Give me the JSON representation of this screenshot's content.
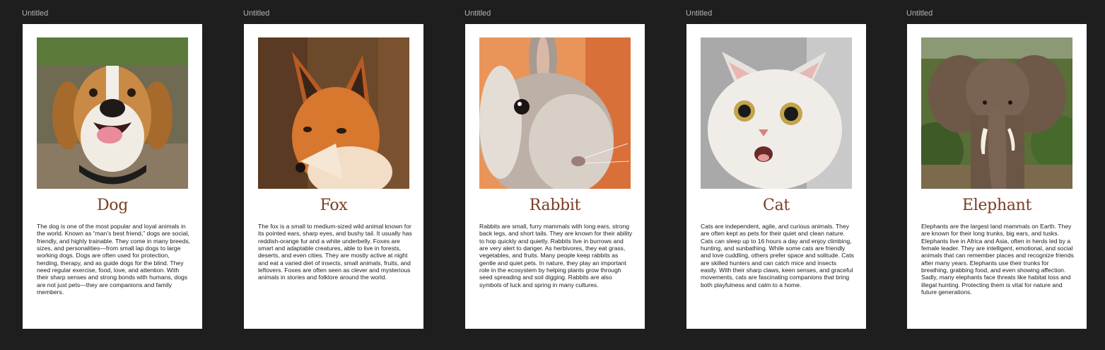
{
  "frames": [
    {
      "label": "Untitled",
      "title": "Dog",
      "image_icon": "dog-photo",
      "text": "The dog is one of the most popular and loyal animals in the world. Known as “man’s best friend,” dogs are social, friendly, and highly trainable. They come in many breeds, sizes, and personalities—from small lap dogs to large working dogs. Dogs are often used for protection, herding, therapy, and as guide dogs for the blind. They need regular exercise, food, love, and attention. With their sharp senses and strong bonds with humans, dogs are not just pets—they are companions and family members."
    },
    {
      "label": "Untitled",
      "title": "Fox",
      "image_icon": "fox-photo",
      "text": "The fox is a small to medium-sized wild animal known for its pointed ears, sharp eyes, and bushy tail. It usually has reddish-orange fur and a white underbelly. Foxes are smart and adaptable creatures, able to live in forests, deserts, and even cities. They are mostly active at night and eat a varied diet of insects, small animals, fruits, and leftovers. Foxes are often seen as clever and mysterious animals in stories and folklore around the world."
    },
    {
      "label": "Untitled",
      "title": "Rabbit",
      "image_icon": "rabbit-photo",
      "text": "Rabbits are small, furry mammals with long ears, strong back legs, and short tails. They are known for their ability to hop quickly and quietly. Rabbits live in burrows and are very alert to danger. As herbivores, they eat grass, vegetables, and fruits. Many people keep rabbits as gentle and quiet pets. In nature, they play an important role in the ecosystem by helping plants grow through seed spreading and soil digging. Rabbits are also symbols of luck and spring in many cultures."
    },
    {
      "label": "Untitled",
      "title": "Cat",
      "image_icon": "cat-photo",
      "text": "Cats are independent, agile, and curious animals. They are often kept as pets for their quiet and clean nature. Cats can sleep up to 16 hours a day and enjoy climbing, hunting, and sunbathing. While some cats are friendly and love cuddling, others prefer space and solitude. Cats are skilled hunters and can catch mice and insects easily. With their sharp claws, keen senses, and graceful movements, cats are fascinating companions that bring both playfulness and calm to a home."
    },
    {
      "label": "Untitled",
      "title": "Elephant",
      "image_icon": "elephant-photo",
      "text": "Elephants are the largest land mammals on Earth. They are known for their long trunks, big ears, and tusks. Elephants live in Africa and Asia, often in herds led by a female leader. They are intelligent, emotional, and social animals that can remember places and recognize friends after many years. Elephants use their trunks for breathing, grabbing food, and even showing affection. Sadly, many elephants face threats like habitat loss and illegal hunting. Protecting them is vital for nature and future generations."
    }
  ],
  "colors": {
    "canvas_background": "#1e1e1e",
    "card_background": "#ffffff",
    "title_color": "#7a3d22",
    "label_color": "#b3b3b3"
  }
}
